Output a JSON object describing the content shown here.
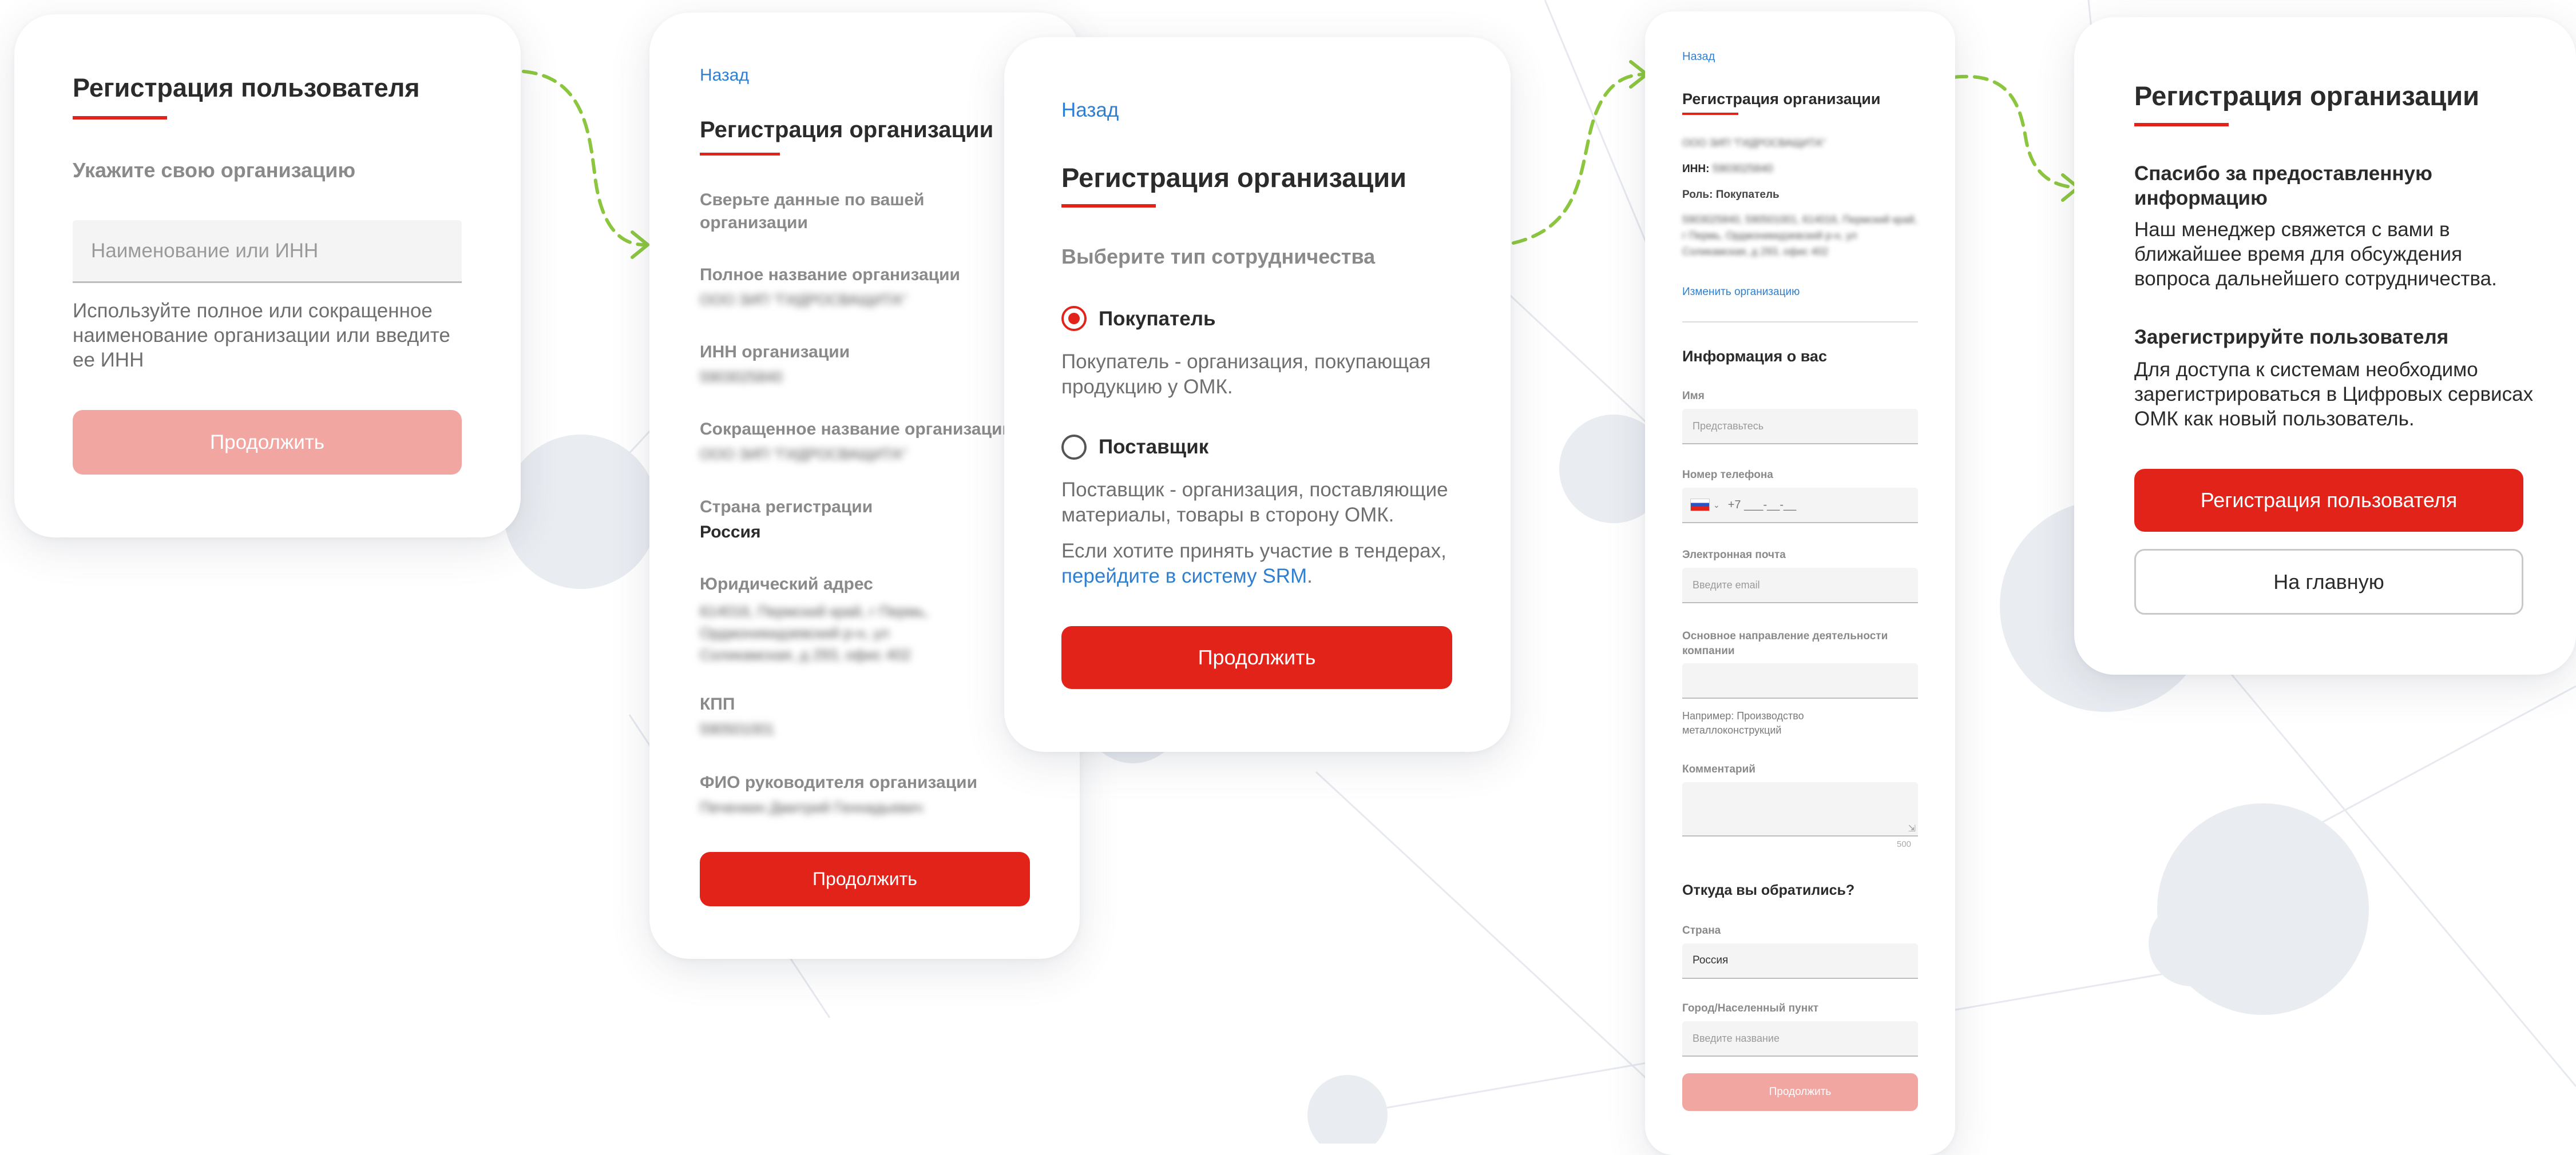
{
  "card1": {
    "title": "Регистрация пользователя",
    "subtitle": "Укажите свою организацию",
    "input_placeholder": "Наименование или ИНН",
    "hint": "Используйте полное или сокращенное наименование организации или введите ее ИНН",
    "button": "Продолжить"
  },
  "card2": {
    "back": "Назад",
    "title": "Регистрация организации",
    "intro": "Сверьте данные по вашей организации",
    "fields": {
      "full_name": {
        "label": "Полное название организации",
        "value": "ООО ЗИП \"ГИДРОСВАЩИТА\""
      },
      "inn": {
        "label": "ИНН организации",
        "value": "5903025840"
      },
      "short_name": {
        "label": "Сокращенное название организации",
        "value": "ООО ЗИП \"ГИДРОСВАЩИТА\""
      },
      "country": {
        "label": "Страна регистрации",
        "value": "Россия"
      },
      "address": {
        "label": "Юридический адрес",
        "value": "614016, Пермский край, г Пермь, Орджоникидзевский р-н, ул Соликамская, д 293, офис 402"
      },
      "kpp": {
        "label": "КПП",
        "value": "590501001"
      },
      "director": {
        "label": "ФИО руководителя организации",
        "value": "Печенкин Дмитрий Геннадьевич"
      }
    },
    "button": "Продолжить"
  },
  "card3": {
    "back": "Назад",
    "title": "Регистрация организации",
    "subtitle": "Выберите тип сотрудничества",
    "buyer_label": "Покупатель",
    "buyer_desc": "Покупатель - организация, покупающая продукцию у ОМК.",
    "supplier_label": "Поставщик",
    "supplier_desc": "Поставщик - организация, поставляющие материалы, товары в сторону ОМК.",
    "tender_text": "Если хотите принять участие в тендерах,",
    "tender_link": "перейдите в систему SRM",
    "tender_end": ".",
    "button": "Продолжить"
  },
  "card4": {
    "back": "Назад",
    "title": "Регистрация организации",
    "org_name": "ООО ЗИП \"ГИДРОСВАЩИТА\"",
    "inn_label": "ИНН:",
    "inn_value": "5903025840",
    "role": "Роль: Покупатель",
    "address": "5903025840, 590501001, 614016, Пермский край, г Пермь, Орджоникидзевский р-н, ул Соликамская, д 293, офис 402",
    "change_link": "Изменить организацию",
    "section_title": "Информация о вас",
    "name_label": "Имя",
    "name_placeholder": "Представьтесь",
    "phone_label": "Номер телефона",
    "phone_value": "+7 ___-__-__",
    "email_label": "Электронная почта",
    "email_placeholder": "Введите email",
    "activity_label": "Основное направление деятельности компании",
    "activity_hint": "Например: Производство металлоконструкций",
    "comment_label": "Комментарий",
    "comment_counter": "500",
    "source_title": "Откуда вы обратились?",
    "country_label": "Страна",
    "country_value": "Россия",
    "city_label": "Город/Населенный пункт",
    "city_placeholder": "Введите название",
    "button": "Продолжить"
  },
  "card5": {
    "title": "Регистрация организации",
    "thanks_title": "Спасибо за предоставленную информацию",
    "thanks_text": "Наш менеджер свяжется с вами в ближайшее время для обсуждения вопроса дальнейшего сотрудничества.",
    "register_title": "Зарегистрируйте пользователя",
    "register_text": "Для доступа к системам необходимо зарегистрироваться в Цифровых сервисах ОМК как новый пользователь.",
    "primary_button": "Регистрация пользователя",
    "secondary_button": "На главную"
  },
  "colors": {
    "accent_red": "#e2231a",
    "pale_red": "#f2a6a2",
    "link_blue": "#2f7fd1",
    "arrow_green": "#8cc63f"
  }
}
